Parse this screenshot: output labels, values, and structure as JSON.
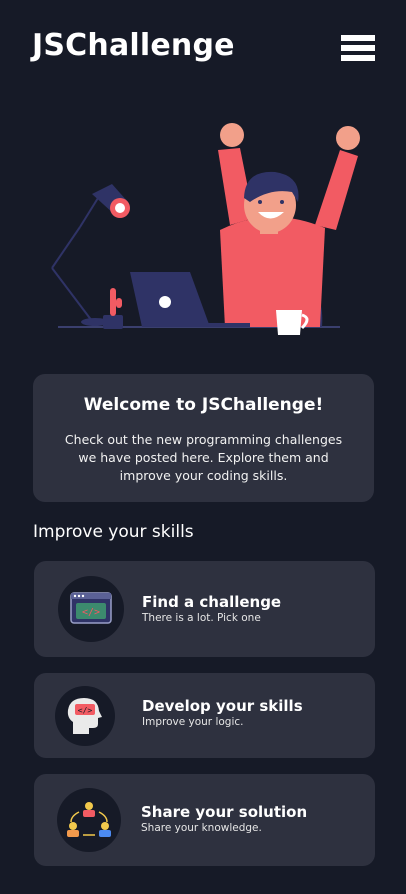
{
  "header": {
    "title": "JSChallenge",
    "menu_icon": "hamburger-menu-icon"
  },
  "hero": {
    "illustration": "celebrating-developer-illustration"
  },
  "welcome": {
    "title": "Welcome to JSChallenge!",
    "text": "Check out the new programming  challenges we have posted  here. Explore them and improve your coding skills."
  },
  "skills_section": {
    "title": "Improve your skills",
    "cards": [
      {
        "title": "Find a challenge",
        "subtitle": "There is a lot. Pick one",
        "icon": "code-window-icon"
      },
      {
        "title": "Develop your skills",
        "subtitle": "Improve your logic.",
        "icon": "head-code-icon"
      },
      {
        "title": "Share your solution",
        "subtitle": "Share your knowledge.",
        "icon": "people-share-icon"
      }
    ]
  },
  "colors": {
    "background": "#161a27",
    "card": "#2e313f",
    "accent_red": "#f25b63",
    "navy": "#2f3366"
  }
}
